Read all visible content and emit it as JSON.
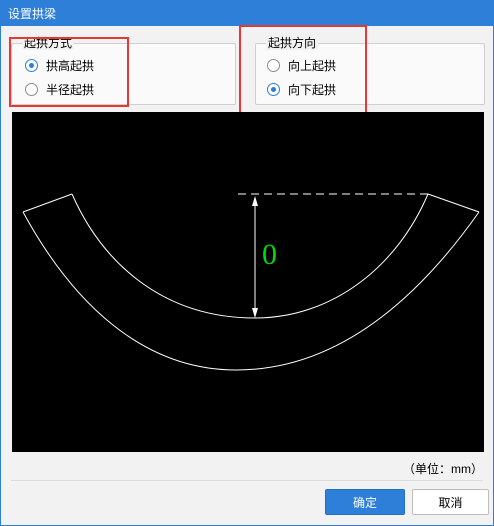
{
  "window": {
    "title": "设置拱梁"
  },
  "arch_mode": {
    "title": "起拱方式",
    "options": [
      {
        "label": "拱高起拱",
        "checked": true
      },
      {
        "label": "半径起拱",
        "checked": false
      }
    ]
  },
  "arch_direction": {
    "title": "起拱方向",
    "options": [
      {
        "label": "向上起拱",
        "checked": false
      },
      {
        "label": "向下起拱",
        "checked": true
      }
    ]
  },
  "preview": {
    "dimension_value": "0"
  },
  "unit_label": "（单位：mm）",
  "buttons": {
    "ok": "确定",
    "cancel": "取消"
  },
  "colors": {
    "accent": "#2d7fd7",
    "highlight": "#e53935",
    "dimension_text": "#00dd00"
  }
}
